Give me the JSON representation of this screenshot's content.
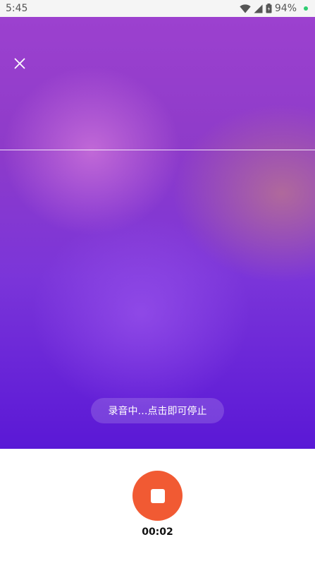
{
  "status_bar": {
    "time": "5:45",
    "battery_percent": "94%",
    "icons": [
      "wifi-icon",
      "signal-icon",
      "battery-icon"
    ],
    "battery_dot_color": "#2ecc71"
  },
  "stage": {
    "close_icon": "close-icon",
    "hint_text": "录音中…点击即可停止",
    "gradient_colors": [
      "#9c41cf",
      "#7b35d9",
      "#5a18d6"
    ]
  },
  "controls": {
    "stop_icon": "stop-icon",
    "stop_color": "#f15a33",
    "timer": "00:02"
  }
}
